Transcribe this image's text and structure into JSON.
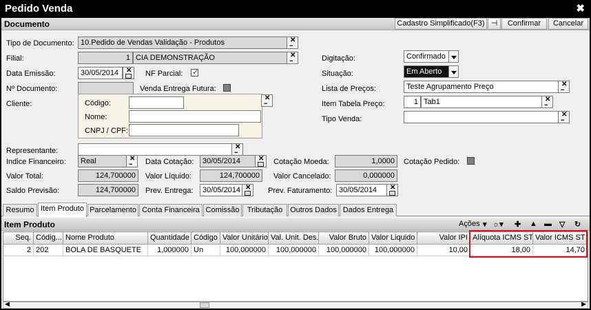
{
  "window": {
    "title": "Pedido Venda",
    "close_glyph": "✖"
  },
  "toolbar": {
    "section_title": "Documento",
    "cadastro_label": "Cadastro Simplificado(F3)",
    "pin_glyph": "⊣",
    "confirm_label": "Confirmar",
    "cancel_label": "Cancelar"
  },
  "form": {
    "tipo_documento": {
      "label": "Tipo de Documento:",
      "value": "10.Pedido de Vendas Validação - Produtos"
    },
    "filial": {
      "label": "Filial:",
      "code": "1",
      "name": "CIA DEMONSTRAÇÃO"
    },
    "data_emissao": {
      "label": "Data Emissão:",
      "value": "30/05/2014"
    },
    "nf_parcial": {
      "label": "NF Parcial:",
      "checked": true
    },
    "numero_documento": {
      "label": "Nº Documento:",
      "value": ""
    },
    "venda_entrega_futura": {
      "label": "Venda Entrega Futura:"
    },
    "cliente": {
      "label": "Cliente:",
      "codigo_label": "Código:",
      "nome_label": "Nome:",
      "cnpj_label": "CNPJ / CPF:"
    },
    "digitacao": {
      "label": "Digitação:",
      "value": "Confirmado"
    },
    "situacao": {
      "label": "Situação:",
      "value": "Em Aberto"
    },
    "lista_precos": {
      "label": "Lista de Preços:",
      "value": "Teste Agrupamento Preço"
    },
    "item_tabela_preco": {
      "label": "Item Tabela Preço:",
      "code": "1",
      "name": "Tab1"
    },
    "tipo_venda": {
      "label": "Tipo Venda:",
      "value": ""
    },
    "representante": {
      "label": "Representante:",
      "value": ""
    },
    "indice_financeiro": {
      "label": "Indice Financeiro:",
      "value": "Real"
    },
    "data_cotacao": {
      "label": "Data Cotação:",
      "value": "30/05/2014"
    },
    "cotacao_moeda": {
      "label": "Cotação Moeda:",
      "value": "1,0000"
    },
    "cotacao_pedido": {
      "label": "Cotação Pedido:"
    },
    "valor_total": {
      "label": "Valor Total:",
      "value": "124,700000"
    },
    "valor_liquido": {
      "label": "Valor Líquido:",
      "value": "124,700000"
    },
    "valor_cancelado": {
      "label": "Valor Cancelado:",
      "value": "0,000000"
    },
    "saldo_previsao": {
      "label": "Saldo Previsão:",
      "value": "124,700000"
    },
    "prev_entrega": {
      "label": "Prev. Entrega:",
      "value": "30/05/2014"
    },
    "prev_faturamento": {
      "label": "Prev. Faturamento:",
      "value": "30/05/2014"
    }
  },
  "tabs": [
    {
      "label": "Resumo"
    },
    {
      "label": "Item Produto"
    },
    {
      "label": "Parcelamento"
    },
    {
      "label": "Conta Financeira"
    },
    {
      "label": "Comissão"
    },
    {
      "label": "Tributação"
    },
    {
      "label": "Outros Dados"
    },
    {
      "label": "Dados Entrega"
    }
  ],
  "grid": {
    "section_title": "Item Produto",
    "acoes_label": "Ações",
    "columns": [
      "Seq.",
      "Códig...",
      "Nome Produto",
      "Quantidade",
      "Código",
      "Valor Unitário",
      "Val. Unit. Des.",
      "Valor Bruto",
      "Valor Liquido",
      "Valor IPI",
      "Alíquota ICMS ST",
      "Valor ICMS ST"
    ],
    "rows": [
      [
        "2",
        "202",
        "BOLA DE BASQUETE",
        "1,000000",
        "Un",
        "100,000000",
        "100,000000",
        "100,000000",
        "100,000000",
        "10,00",
        "18,00",
        "14,70"
      ]
    ]
  },
  "colors": {
    "highlight": "#e0101e",
    "titlebar": "#000000"
  }
}
